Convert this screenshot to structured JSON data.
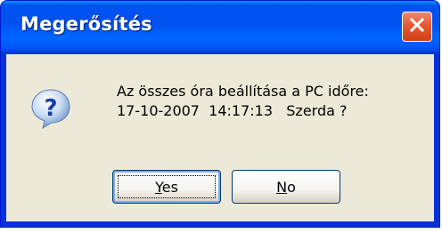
{
  "dialog": {
    "title": "Megerősítés",
    "icon": "question-icon",
    "message_line1": "Az összes óra beállítása a PC időre:",
    "message_line2": "17-10-2007  14:17:13   Szerda ?",
    "buttons": {
      "yes_label": "Yes",
      "no_label": "No"
    },
    "close_icon": "close-icon"
  },
  "colors": {
    "titlebar": "#0053ee",
    "window_frame": "#0831d9",
    "client_bg": "#ece9d8",
    "close_button": "#e35a34",
    "button_border": "#003c74"
  }
}
